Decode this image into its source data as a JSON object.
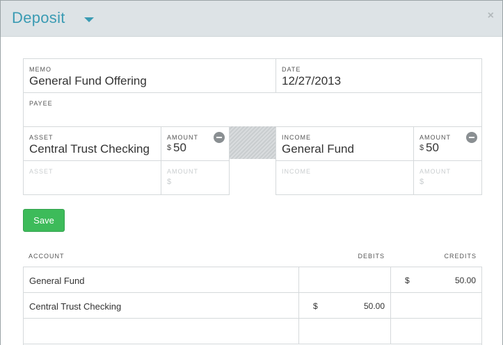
{
  "header": {
    "title": "Deposit",
    "close_glyph": "×"
  },
  "form": {
    "memo": {
      "label": "MEMO",
      "value": "General Fund Offering"
    },
    "date": {
      "label": "DATE",
      "value": "12/27/2013"
    },
    "payee": {
      "label": "PAYEE",
      "value": ""
    },
    "asset_rows": [
      {
        "asset_label": "ASSET",
        "asset_value": "Central Trust Checking",
        "amount_label": "AMOUNT",
        "currency": "$",
        "amount": "50"
      },
      {
        "asset_label": "ASSET",
        "asset_value": "",
        "amount_label": "AMOUNT",
        "currency": "$",
        "amount": ""
      }
    ],
    "income_rows": [
      {
        "income_label": "INCOME",
        "income_value": "General Fund",
        "amount_label": "AMOUNT",
        "currency": "$",
        "amount": "50"
      },
      {
        "income_label": "INCOME",
        "income_value": "",
        "amount_label": "AMOUNT",
        "currency": "$",
        "amount": ""
      }
    ]
  },
  "actions": {
    "save_label": "Save"
  },
  "ledger": {
    "columns": [
      "ACCOUNT",
      "DEBITS",
      "CREDITS"
    ],
    "rows": [
      {
        "account": "General Fund",
        "debit_sign": "",
        "debit": "",
        "credit_sign": "$",
        "credit": "50.00"
      },
      {
        "account": "Central Trust Checking",
        "debit_sign": "$",
        "debit": "50.00",
        "credit_sign": "",
        "credit": ""
      },
      {
        "account": "",
        "debit_sign": "",
        "debit": "",
        "credit_sign": "",
        "credit": ""
      }
    ]
  },
  "icons": {
    "title_dropdown": "chevron-down-icon",
    "close": "close-icon",
    "remove_line": "minus-circle-icon"
  },
  "colors": {
    "title": "#3a9bb3",
    "header_bg": "#dde3e6",
    "save_button": "#3dbb5a",
    "remove_icon": "#8a8f92"
  }
}
